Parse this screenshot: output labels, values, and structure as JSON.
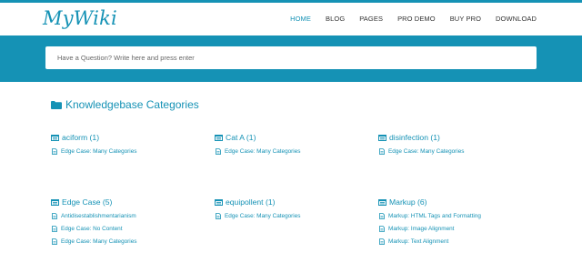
{
  "site": {
    "logo": "MyWiki"
  },
  "nav": {
    "items": [
      {
        "label": "HOME",
        "active": true
      },
      {
        "label": "BLOG",
        "active": false
      },
      {
        "label": "PAGES",
        "active": false
      },
      {
        "label": "PRO DEMO",
        "active": false
      },
      {
        "label": "BUY PRO",
        "active": false
      },
      {
        "label": "DOWNLOAD",
        "active": false
      }
    ]
  },
  "search": {
    "placeholder": "Have a Question? Write here and press enter"
  },
  "section": {
    "title": "Knowledgebase Categories"
  },
  "categories": [
    {
      "title": "aciform (1)",
      "items": [
        "Edge Case: Many Categories"
      ]
    },
    {
      "title": "Cat A (1)",
      "items": [
        "Edge Case: Many Categories"
      ]
    },
    {
      "title": "disinfection (1)",
      "items": [
        "Edge Case: Many Categories"
      ]
    },
    {
      "title": "Edge Case (5)",
      "items": [
        "Antidisestablishmentarianism",
        "Edge Case: No Content",
        "Edge Case: Many Categories"
      ]
    },
    {
      "title": "equipollent (1)",
      "items": [
        "Edge Case: Many Categories"
      ]
    },
    {
      "title": "Markup (6)",
      "items": [
        "Markup: HTML Tags and Formatting",
        "Markup: Image Alignment",
        "Markup: Text Alignment"
      ]
    }
  ],
  "colors": {
    "accent": "#1592b5",
    "nav_text": "#333333",
    "background": "#ffffff"
  }
}
